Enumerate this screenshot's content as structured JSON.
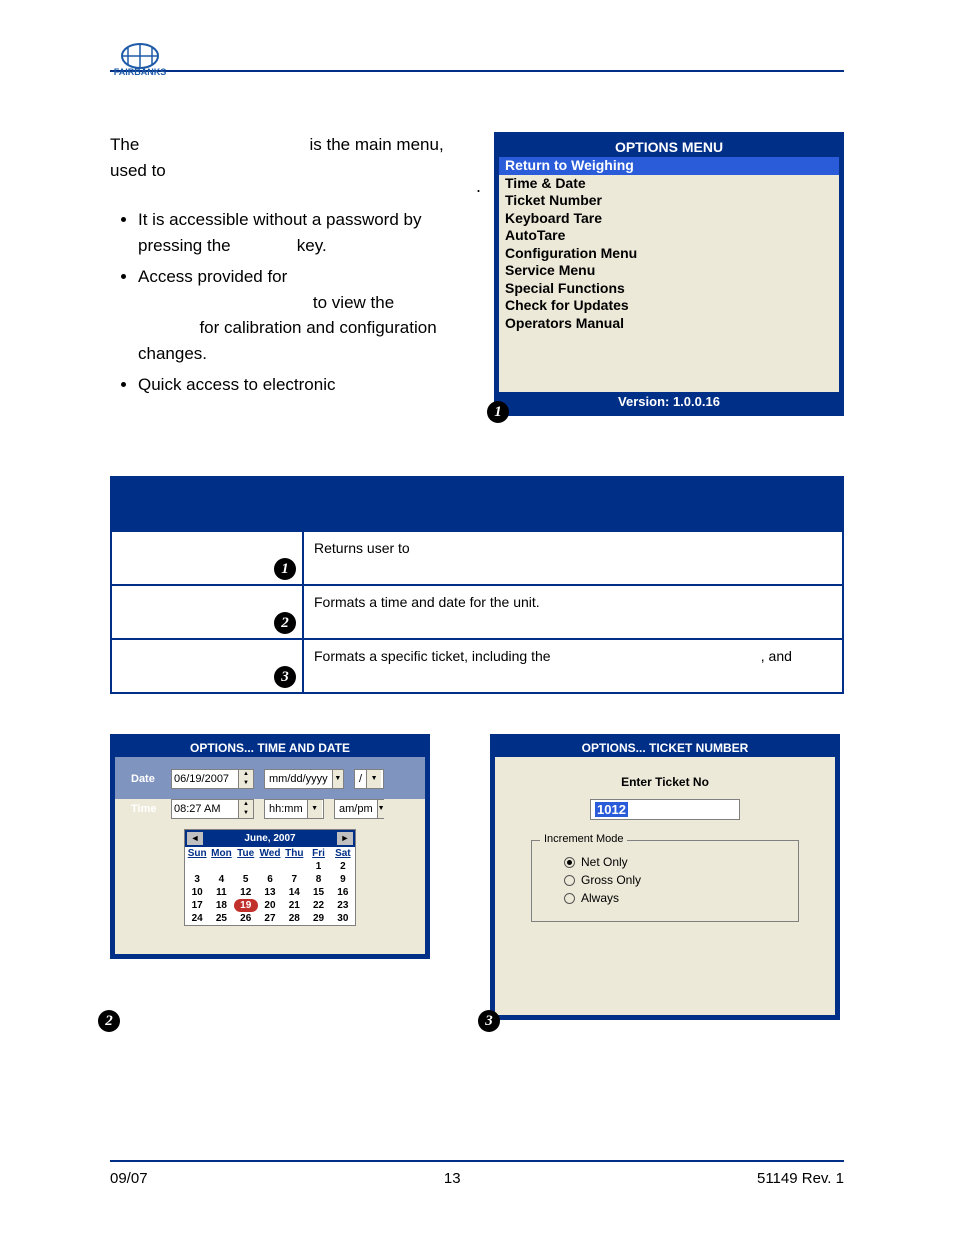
{
  "intro": {
    "line1a": "The ",
    "line1b": " is the main menu,",
    "line2": "used to"
  },
  "bullets": [
    {
      "a": "It is accessible without a password by pressing the ",
      "b": " key."
    },
    {
      "a": "Access provided for ",
      "mid": " to view the ",
      "b": " for calibration and configuration changes."
    },
    {
      "a": "Quick access to electronic"
    }
  ],
  "optionsMenu": {
    "title": "OPTIONS MENU",
    "items": [
      "Return to Weighing",
      "Time & Date",
      "Ticket Number",
      "Keyboard Tare",
      "AutoTare",
      "Configuration Menu",
      "Service Menu",
      "Special Functions",
      "Check for Updates",
      "Operators Manual"
    ],
    "version": "Version: 1.0.0.16"
  },
  "table": {
    "rows": [
      {
        "desc": "Returns user to"
      },
      {
        "desc": "Formats a time and date for the unit."
      },
      {
        "desc": "Formats a specific ticket, including the ",
        "desc2": " , and"
      }
    ]
  },
  "timeDate": {
    "title": "OPTIONS... TIME AND DATE",
    "dateLabel": "Date",
    "timeLabel": "Time",
    "dateVal": "06/19/2007",
    "timeVal": "08:27 AM",
    "dateFmt": "mm/dd/yyyy",
    "sep": "/",
    "timeFmt": "hh:mm",
    "ampm": "am/pm",
    "calMonth": "June, 2007",
    "dow": [
      "Sun",
      "Mon",
      "Tue",
      "Wed",
      "Thu",
      "Fri",
      "Sat"
    ],
    "days": [
      [
        "",
        "",
        "",
        "",
        "",
        "1",
        "2"
      ],
      [
        "3",
        "4",
        "5",
        "6",
        "7",
        "8",
        "9"
      ],
      [
        "10",
        "11",
        "12",
        "13",
        "14",
        "15",
        "16"
      ],
      [
        "17",
        "18",
        "19",
        "20",
        "21",
        "22",
        "23"
      ],
      [
        "24",
        "25",
        "26",
        "27",
        "28",
        "29",
        "30"
      ]
    ],
    "today": "19"
  },
  "ticket": {
    "title": "OPTIONS... TICKET NUMBER",
    "enterLabel": "Enter Ticket No",
    "value": "1012",
    "incLegend": "Increment Mode",
    "opts": [
      "Net Only",
      "Gross Only",
      "Always"
    ],
    "selected": 0
  },
  "callouts": {
    "c1": "1",
    "c2": "2",
    "c3": "3"
  },
  "footer": {
    "left": "09/07",
    "center": "13",
    "right": "51149   Rev. 1"
  }
}
